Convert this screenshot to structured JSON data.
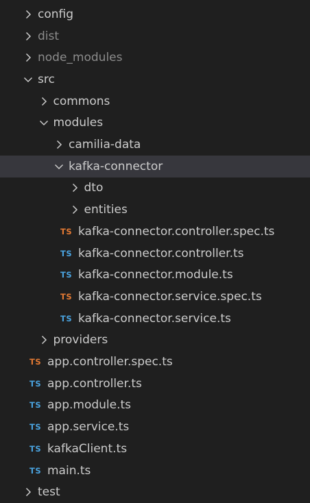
{
  "colors": {
    "background": "#1f1f1f",
    "selected_row": "#37373d",
    "text": "#cccccc",
    "dim_text": "#8c8c8c",
    "ts_blue": "#4aa3df",
    "ts_orange": "#e37933"
  },
  "tree": [
    {
      "label": "config",
      "kind": "folder",
      "expanded": false,
      "depth": 0
    },
    {
      "label": "dist",
      "kind": "folder",
      "expanded": false,
      "depth": 0,
      "dim": true
    },
    {
      "label": "node_modules",
      "kind": "folder",
      "expanded": false,
      "depth": 0,
      "dim": true
    },
    {
      "label": "src",
      "kind": "folder",
      "expanded": true,
      "depth": 0
    },
    {
      "label": "commons",
      "kind": "folder",
      "expanded": false,
      "depth": 1
    },
    {
      "label": "modules",
      "kind": "folder",
      "expanded": true,
      "depth": 1
    },
    {
      "label": "camilia-data",
      "kind": "folder",
      "expanded": false,
      "depth": 2
    },
    {
      "label": "kafka-connector",
      "kind": "folder",
      "expanded": true,
      "depth": 2,
      "selected": true
    },
    {
      "label": "dto",
      "kind": "folder",
      "expanded": false,
      "depth": 3
    },
    {
      "label": "entities",
      "kind": "folder",
      "expanded": false,
      "depth": 3
    },
    {
      "label": "kafka-connector.controller.spec.ts",
      "kind": "file",
      "icon": "TS",
      "icon_color": "orange",
      "depth": 3
    },
    {
      "label": "kafka-connector.controller.ts",
      "kind": "file",
      "icon": "TS",
      "icon_color": "blue",
      "depth": 3
    },
    {
      "label": "kafka-connector.module.ts",
      "kind": "file",
      "icon": "TS",
      "icon_color": "blue",
      "depth": 3
    },
    {
      "label": "kafka-connector.service.spec.ts",
      "kind": "file",
      "icon": "TS",
      "icon_color": "orange",
      "depth": 3
    },
    {
      "label": "kafka-connector.service.ts",
      "kind": "file",
      "icon": "TS",
      "icon_color": "blue",
      "depth": 3
    },
    {
      "label": "providers",
      "kind": "folder",
      "expanded": false,
      "depth": 1
    },
    {
      "label": "app.controller.spec.ts",
      "kind": "file",
      "icon": "TS",
      "icon_color": "orange",
      "depth": 1
    },
    {
      "label": "app.controller.ts",
      "kind": "file",
      "icon": "TS",
      "icon_color": "blue",
      "depth": 1
    },
    {
      "label": "app.module.ts",
      "kind": "file",
      "icon": "TS",
      "icon_color": "blue",
      "depth": 1
    },
    {
      "label": "app.service.ts",
      "kind": "file",
      "icon": "TS",
      "icon_color": "blue",
      "depth": 1
    },
    {
      "label": "kafkaClient.ts",
      "kind": "file",
      "icon": "TS",
      "icon_color": "blue",
      "depth": 1
    },
    {
      "label": "main.ts",
      "kind": "file",
      "icon": "TS",
      "icon_color": "blue",
      "depth": 1
    },
    {
      "label": "test",
      "kind": "folder",
      "expanded": false,
      "depth": 0
    }
  ]
}
